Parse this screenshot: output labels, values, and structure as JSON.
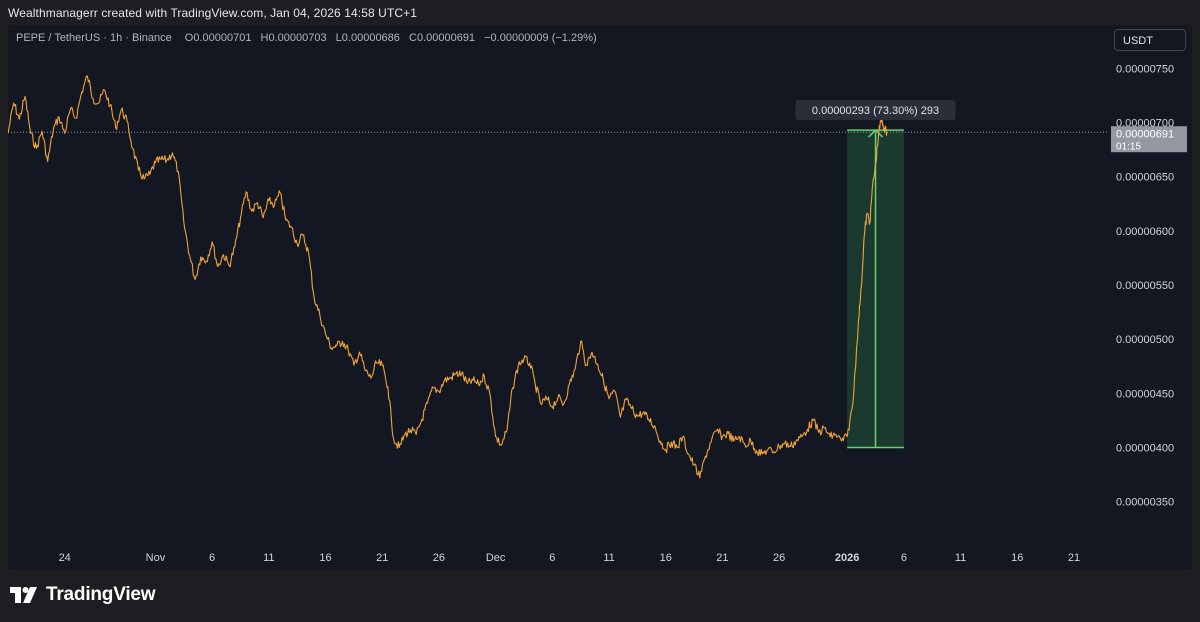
{
  "caption": "Wealthmanagerr created with TradingView.com, Jan 04, 2026 14:58 UTC+1",
  "legend": {
    "symbol": "PEPE / TetherUS · 1h · Binance",
    "open_label": "O",
    "open": "0.00000701",
    "high_label": "H",
    "high": "0.00000703",
    "low_label": "L",
    "low": "0.00000686",
    "close_label": "C",
    "close": "0.00000691",
    "change": "−0.00000009 (−1.29%)"
  },
  "currency_button": "USDT",
  "brand": "TradingView",
  "colors": {
    "background": "#131722",
    "price_line": "#f0a33a",
    "measure_fill": "#1f4a35",
    "measure_line": "#66d36e",
    "price_badge": "#9598a1"
  },
  "icons": {
    "logo": "tradingview-logo-icon",
    "measure_arrow": "arrow-up-icon"
  },
  "chart_data": {
    "type": "line",
    "title": "PEPE / TetherUS · 1h · Binance",
    "xlabel": "",
    "ylabel": "",
    "ylim": [
      3.1e-06,
      7.9e-06
    ],
    "xlim": [
      "2025-10-19",
      "2026-01-24"
    ],
    "y_ticks": [
      "0.00000750",
      "0.00000700",
      "0.00000650",
      "0.00000600",
      "0.00000550",
      "0.00000500",
      "0.00000450",
      "0.00000400",
      "0.00000350"
    ],
    "x_ticks": [
      {
        "date": "2025-10-24",
        "label": "24",
        "bold": false
      },
      {
        "date": "2025-11-01",
        "label": "Nov",
        "bold": false
      },
      {
        "date": "2025-11-06",
        "label": "6",
        "bold": false
      },
      {
        "date": "2025-11-11",
        "label": "11",
        "bold": false
      },
      {
        "date": "2025-11-16",
        "label": "16",
        "bold": false
      },
      {
        "date": "2025-11-21",
        "label": "21",
        "bold": false
      },
      {
        "date": "2025-11-26",
        "label": "26",
        "bold": false
      },
      {
        "date": "2025-12-01",
        "label": "Dec",
        "bold": false
      },
      {
        "date": "2025-12-06",
        "label": "6",
        "bold": false
      },
      {
        "date": "2025-12-11",
        "label": "11",
        "bold": false
      },
      {
        "date": "2025-12-16",
        "label": "16",
        "bold": false
      },
      {
        "date": "2025-12-21",
        "label": "21",
        "bold": false
      },
      {
        "date": "2025-12-26",
        "label": "26",
        "bold": false
      },
      {
        "date": "2026-01-01",
        "label": "2026",
        "bold": true
      },
      {
        "date": "2026-01-06",
        "label": "6",
        "bold": false
      },
      {
        "date": "2026-01-11",
        "label": "11",
        "bold": false
      },
      {
        "date": "2026-01-16",
        "label": "16",
        "bold": false
      },
      {
        "date": "2026-01-21",
        "label": "21",
        "bold": false
      }
    ],
    "series": [
      {
        "values": [
          [
            "2025-10-19 00:00",
            6.9e-06
          ],
          [
            "2025-10-19 12:00",
            7.18e-06
          ],
          [
            "2025-10-20 00:00",
            7.03e-06
          ],
          [
            "2025-10-20 12:00",
            7.24e-06
          ],
          [
            "2025-10-21 00:00",
            6.9e-06
          ],
          [
            "2025-10-21 12:00",
            6.76e-06
          ],
          [
            "2025-10-22 00:00",
            6.92e-06
          ],
          [
            "2025-10-22 12:00",
            6.64e-06
          ],
          [
            "2025-10-23 00:00",
            6.94e-06
          ],
          [
            "2025-10-23 12:00",
            7.05e-06
          ],
          [
            "2025-10-24 00:00",
            6.9e-06
          ],
          [
            "2025-10-24 12:00",
            7.12e-06
          ],
          [
            "2025-10-25 00:00",
            7.04e-06
          ],
          [
            "2025-10-25 12:00",
            7.28e-06
          ],
          [
            "2025-10-26 00:00",
            7.43e-06
          ],
          [
            "2025-10-26 12:00",
            7.22e-06
          ],
          [
            "2025-10-27 00:00",
            7.18e-06
          ],
          [
            "2025-10-27 12:00",
            7.3e-06
          ],
          [
            "2025-10-28 00:00",
            7.16e-06
          ],
          [
            "2025-10-28 12:00",
            6.95e-06
          ],
          [
            "2025-10-29 00:00",
            7.12e-06
          ],
          [
            "2025-10-29 12:00",
            7.01e-06
          ],
          [
            "2025-10-30 00:00",
            6.76e-06
          ],
          [
            "2025-10-30 12:00",
            6.56e-06
          ],
          [
            "2025-10-31 00:00",
            6.48e-06
          ],
          [
            "2025-10-31 12:00",
            6.52e-06
          ],
          [
            "2025-11-01 00:00",
            6.63e-06
          ],
          [
            "2025-11-01 12:00",
            6.66e-06
          ],
          [
            "2025-11-02 00:00",
            6.65e-06
          ],
          [
            "2025-11-02 12:00",
            6.72e-06
          ],
          [
            "2025-11-03 00:00",
            6.55e-06
          ],
          [
            "2025-11-03 12:00",
            6.08e-06
          ],
          [
            "2025-11-04 00:00",
            5.78e-06
          ],
          [
            "2025-11-04 12:00",
            5.55e-06
          ],
          [
            "2025-11-05 00:00",
            5.76e-06
          ],
          [
            "2025-11-05 12:00",
            5.72e-06
          ],
          [
            "2025-11-06 00:00",
            5.9e-06
          ],
          [
            "2025-11-06 12:00",
            5.67e-06
          ],
          [
            "2025-11-07 00:00",
            5.78e-06
          ],
          [
            "2025-11-07 12:00",
            5.68e-06
          ],
          [
            "2025-11-08 00:00",
            5.85e-06
          ],
          [
            "2025-11-08 12:00",
            6.12e-06
          ],
          [
            "2025-11-09 00:00",
            6.36e-06
          ],
          [
            "2025-11-09 12:00",
            6.18e-06
          ],
          [
            "2025-11-10 00:00",
            6.26e-06
          ],
          [
            "2025-11-10 12:00",
            6.12e-06
          ],
          [
            "2025-11-11 00:00",
            6.28e-06
          ],
          [
            "2025-11-11 12:00",
            6.24e-06
          ],
          [
            "2025-11-12 00:00",
            6.35e-06
          ],
          [
            "2025-11-12 12:00",
            6.1e-06
          ],
          [
            "2025-11-13 00:00",
            6.03e-06
          ],
          [
            "2025-11-13 12:00",
            5.88e-06
          ],
          [
            "2025-11-14 00:00",
            5.96e-06
          ],
          [
            "2025-11-14 12:00",
            5.8e-06
          ],
          [
            "2025-11-15 00:00",
            5.38e-06
          ],
          [
            "2025-11-15 12:00",
            5.22e-06
          ],
          [
            "2025-11-16 00:00",
            5.05e-06
          ],
          [
            "2025-11-16 12:00",
            4.92e-06
          ],
          [
            "2025-11-17 00:00",
            4.94e-06
          ],
          [
            "2025-11-17 12:00",
            4.98e-06
          ],
          [
            "2025-11-18 00:00",
            4.9e-06
          ],
          [
            "2025-11-18 12:00",
            4.76e-06
          ],
          [
            "2025-11-19 00:00",
            4.88e-06
          ],
          [
            "2025-11-19 12:00",
            4.71e-06
          ],
          [
            "2025-11-20 00:00",
            4.64e-06
          ],
          [
            "2025-11-20 12:00",
            4.78e-06
          ],
          [
            "2025-11-21 00:00",
            4.76e-06
          ],
          [
            "2025-11-21 12:00",
            4.56e-06
          ],
          [
            "2025-11-22 00:00",
            4.08e-06
          ],
          [
            "2025-11-22 12:00",
            4e-06
          ],
          [
            "2025-11-23 00:00",
            4.12e-06
          ],
          [
            "2025-11-23 12:00",
            4.16e-06
          ],
          [
            "2025-11-24 00:00",
            4.12e-06
          ],
          [
            "2025-11-24 12:00",
            4.26e-06
          ],
          [
            "2025-11-25 00:00",
            4.41e-06
          ],
          [
            "2025-11-25 12:00",
            4.55e-06
          ],
          [
            "2025-11-26 00:00",
            4.52e-06
          ],
          [
            "2025-11-26 12:00",
            4.62e-06
          ],
          [
            "2025-11-27 00:00",
            4.64e-06
          ],
          [
            "2025-11-27 12:00",
            4.68e-06
          ],
          [
            "2025-11-28 00:00",
            4.68e-06
          ],
          [
            "2025-11-28 12:00",
            4.59e-06
          ],
          [
            "2025-11-29 00:00",
            4.62e-06
          ],
          [
            "2025-11-29 12:00",
            4.58e-06
          ],
          [
            "2025-11-30 00:00",
            4.66e-06
          ],
          [
            "2025-11-30 12:00",
            4.49e-06
          ],
          [
            "2025-12-01 00:00",
            4.1e-06
          ],
          [
            "2025-12-01 12:00",
            4.02e-06
          ],
          [
            "2025-12-02 00:00",
            4.16e-06
          ],
          [
            "2025-12-02 12:00",
            4.55e-06
          ],
          [
            "2025-12-03 00:00",
            4.76e-06
          ],
          [
            "2025-12-03 12:00",
            4.82e-06
          ],
          [
            "2025-12-04 00:00",
            4.78e-06
          ],
          [
            "2025-12-04 12:00",
            4.58e-06
          ],
          [
            "2025-12-05 00:00",
            4.4e-06
          ],
          [
            "2025-12-05 12:00",
            4.45e-06
          ],
          [
            "2025-12-06 00:00",
            4.38e-06
          ],
          [
            "2025-12-06 12:00",
            4.46e-06
          ],
          [
            "2025-12-07 00:00",
            4.4e-06
          ],
          [
            "2025-12-07 12:00",
            4.58e-06
          ],
          [
            "2025-12-08 00:00",
            4.72e-06
          ],
          [
            "2025-12-08 12:00",
            4.98e-06
          ],
          [
            "2025-12-09 00:00",
            4.76e-06
          ],
          [
            "2025-12-09 12:00",
            4.88e-06
          ],
          [
            "2025-12-10 00:00",
            4.77e-06
          ],
          [
            "2025-12-10 12:00",
            4.62e-06
          ],
          [
            "2025-12-11 00:00",
            4.45e-06
          ],
          [
            "2025-12-11 12:00",
            4.52e-06
          ],
          [
            "2025-12-12 00:00",
            4.28e-06
          ],
          [
            "2025-12-12 12:00",
            4.44e-06
          ],
          [
            "2025-12-13 00:00",
            4.36e-06
          ],
          [
            "2025-12-13 12:00",
            4.29e-06
          ],
          [
            "2025-12-14 00:00",
            4.32e-06
          ],
          [
            "2025-12-14 12:00",
            4.26e-06
          ],
          [
            "2025-12-15 00:00",
            4.2e-06
          ],
          [
            "2025-12-15 12:00",
            4.06e-06
          ],
          [
            "2025-12-16 00:00",
            3.98e-06
          ],
          [
            "2025-12-16 12:00",
            4.05e-06
          ],
          [
            "2025-12-17 00:00",
            4e-06
          ],
          [
            "2025-12-17 12:00",
            4.1e-06
          ],
          [
            "2025-12-18 00:00",
            3.94e-06
          ],
          [
            "2025-12-18 12:00",
            3.84e-06
          ],
          [
            "2025-12-19 00:00",
            3.72e-06
          ],
          [
            "2025-12-19 12:00",
            3.92e-06
          ],
          [
            "2025-12-20 00:00",
            4.05e-06
          ],
          [
            "2025-12-20 12:00",
            4.16e-06
          ],
          [
            "2025-12-21 00:00",
            4.1e-06
          ],
          [
            "2025-12-21 12:00",
            4.13e-06
          ],
          [
            "2025-12-22 00:00",
            4.06e-06
          ],
          [
            "2025-12-22 12:00",
            4.1e-06
          ],
          [
            "2025-12-23 00:00",
            4.02e-06
          ],
          [
            "2025-12-23 12:00",
            4.06e-06
          ],
          [
            "2025-12-24 00:00",
            3.97e-06
          ],
          [
            "2025-12-24 12:00",
            3.94e-06
          ],
          [
            "2025-12-25 00:00",
            3.98e-06
          ],
          [
            "2025-12-25 12:00",
            3.96e-06
          ],
          [
            "2025-12-26 00:00",
            4.01e-06
          ],
          [
            "2025-12-26 12:00",
            4.04e-06
          ],
          [
            "2025-12-27 00:00",
            4.01e-06
          ],
          [
            "2025-12-27 12:00",
            4.06e-06
          ],
          [
            "2025-12-28 00:00",
            4.1e-06
          ],
          [
            "2025-12-28 12:00",
            4.17e-06
          ],
          [
            "2025-12-29 00:00",
            4.25e-06
          ],
          [
            "2025-12-29 12:00",
            4.14e-06
          ],
          [
            "2025-12-30 00:00",
            4.18e-06
          ],
          [
            "2025-12-30 12:00",
            4.1e-06
          ],
          [
            "2025-12-31 00:00",
            4.12e-06
          ],
          [
            "2025-12-31 12:00",
            4.06e-06
          ],
          [
            "2026-01-01 00:00",
            4.1e-06
          ],
          [
            "2026-01-01 12:00",
            4.4e-06
          ],
          [
            "2026-01-02 00:00",
            5.18e-06
          ],
          [
            "2026-01-02 06:00",
            5.48e-06
          ],
          [
            "2026-01-02 12:00",
            5.95e-06
          ],
          [
            "2026-01-02 18:00",
            6.16e-06
          ],
          [
            "2026-01-03 00:00",
            6.08e-06
          ],
          [
            "2026-01-03 06:00",
            6.42e-06
          ],
          [
            "2026-01-03 12:00",
            6.6e-06
          ],
          [
            "2026-01-03 18:00",
            6.88e-06
          ],
          [
            "2026-01-04 00:00",
            7.03e-06
          ],
          [
            "2026-01-04 06:00",
            6.95e-06
          ],
          [
            "2026-01-04 12:00",
            6.91e-06
          ]
        ]
      }
    ],
    "annotations": {
      "last_price": "0.00000691",
      "countdown": "01:15",
      "measure": {
        "label": "0.00000293 (73.30%) 293",
        "from_date": "2026-01-01",
        "to_date": "2026-01-06",
        "from_price": 4e-06,
        "to_price": 6.93e-06
      }
    }
  }
}
